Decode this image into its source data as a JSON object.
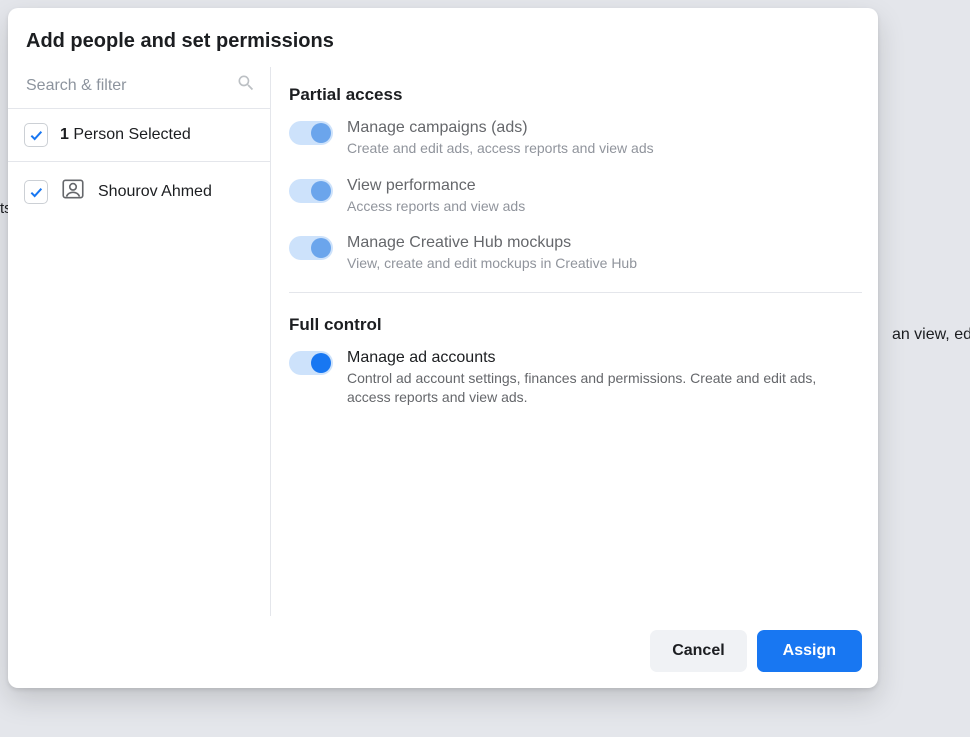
{
  "modal": {
    "title": "Add people and set permissions"
  },
  "search": {
    "placeholder": "Search & filter"
  },
  "selection": {
    "count": "1",
    "label": "Person Selected"
  },
  "people": [
    {
      "name": "Shourov Ahmed"
    }
  ],
  "sections": {
    "partial": "Partial access",
    "full": "Full control"
  },
  "permissions": {
    "campaigns": {
      "title": "Manage campaigns (ads)",
      "desc": "Create and edit ads, access reports and view ads"
    },
    "performance": {
      "title": "View performance",
      "desc": "Access reports and view ads"
    },
    "creative": {
      "title": "Manage Creative Hub mockups",
      "desc": "View, create and edit mockups in Creative Hub"
    },
    "adaccounts": {
      "title": "Manage ad accounts",
      "desc": "Control ad account settings, finances and permissions. Create and edit ads, access reports and view ads."
    }
  },
  "buttons": {
    "cancel": "Cancel",
    "assign": "Assign"
  },
  "backdrop": {
    "right": "an view, edit",
    "left": "ts"
  }
}
